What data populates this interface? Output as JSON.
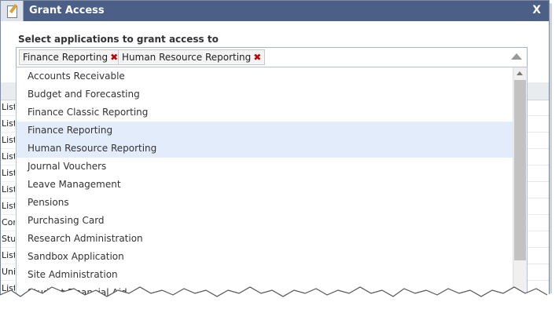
{
  "dialog": {
    "title": "Grant Access",
    "close_label": "X",
    "title_icon": "document-edit-icon"
  },
  "form": {
    "label": "Select applications to grant access to",
    "selected": [
      {
        "label": "Finance Reporting",
        "remove": "✖"
      },
      {
        "label": "Human Resource Reporting",
        "remove": "✖"
      }
    ],
    "caret_icon": "chevron-up-icon"
  },
  "dropdown": {
    "options": [
      {
        "label": "Accounts Receivable",
        "selected": false
      },
      {
        "label": "Budget and Forecasting",
        "selected": false
      },
      {
        "label": "Finance Classic Reporting",
        "selected": false
      },
      {
        "label": "Finance Reporting",
        "selected": true
      },
      {
        "label": "Human Resource Reporting",
        "selected": true
      },
      {
        "label": "Journal Vouchers",
        "selected": false
      },
      {
        "label": "Leave Management",
        "selected": false
      },
      {
        "label": "Pensions",
        "selected": false
      },
      {
        "label": "Purchasing Card",
        "selected": false
      },
      {
        "label": "Research Administration",
        "selected": false
      },
      {
        "label": "Sandbox Application",
        "selected": false
      },
      {
        "label": "Site Administration",
        "selected": false
      },
      {
        "label": "Student Financial Aid",
        "selected": false
      }
    ]
  },
  "background": {
    "left_labels": [
      "List",
      "List",
      "List",
      "List",
      "List",
      "List",
      "List",
      "Con",
      "Stu",
      "List",
      "Uni",
      "List"
    ]
  },
  "colors": {
    "titlebar": "#4c5f86",
    "selected_option": "#e3ecfa",
    "remove_icon": "#c00000"
  }
}
